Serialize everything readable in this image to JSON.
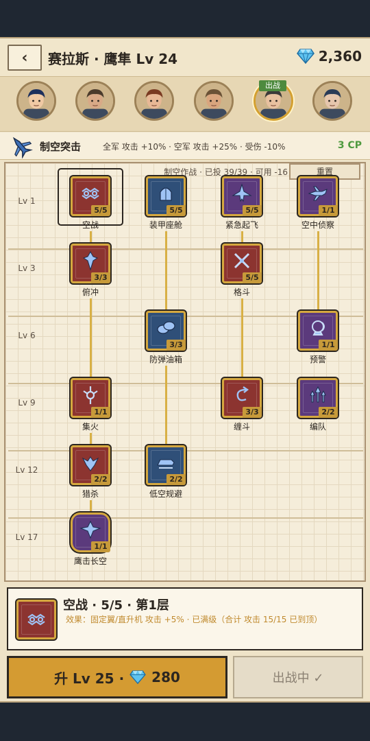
{
  "header": {
    "back_label": "‹",
    "title": "赛拉斯 · 鹰隼 Lv 24",
    "gems": "2,360"
  },
  "portraits": [
    {
      "name": "hero-1",
      "hair": "#1d2f5c",
      "skin": "#f0c9a4"
    },
    {
      "name": "hero-2",
      "hair": "#4a3a2b",
      "skin": "#d8a987"
    },
    {
      "name": "hero-3",
      "hair": "#7a3a22",
      "skin": "#e8b896"
    },
    {
      "name": "hero-4",
      "hair": "#6b5236",
      "skin": "#d9a57e"
    },
    {
      "name": "hero-5",
      "hair": "#3c3a3a",
      "skin": "#e8c1a0"
    },
    {
      "name": "hero-6",
      "hair": "#2a3b57",
      "skin": "#e6c6ad"
    }
  ],
  "deploy_tag": "出战",
  "skillbar": {
    "icon": "fighter-plane-icon",
    "name": "制空突击",
    "effects": "全军 攻击 +10% · 空军 攻击 +25% · 受伤 -10%",
    "cp": "3 CP"
  },
  "tree": {
    "info": "制空作战 · 已投 39/39 · 可用 -16",
    "reset_label": "重置",
    "levels": [
      "Lv 1",
      "Lv 3",
      "Lv 6",
      "Lv 9",
      "Lv 12",
      "Lv 17"
    ],
    "nodes": [
      {
        "id": "air-combat",
        "name": "空战",
        "count": "5/5",
        "color": "red"
      },
      {
        "id": "armored-cockpit",
        "name": "装甲座舱",
        "count": "5/5",
        "color": "blue"
      },
      {
        "id": "scramble",
        "name": "紧急起飞",
        "count": "5/5",
        "color": "purple"
      },
      {
        "id": "air-recon",
        "name": "空中侦察",
        "count": "1/1",
        "color": "purple"
      },
      {
        "id": "dive",
        "name": "俯冲",
        "count": "3/3",
        "color": "red"
      },
      {
        "id": "dogfight",
        "name": "格斗",
        "count": "5/5",
        "color": "red"
      },
      {
        "id": "self-sealing-tank",
        "name": "防弹油箱",
        "count": "3/3",
        "color": "blue"
      },
      {
        "id": "early-warning",
        "name": "预警",
        "count": "1/1",
        "color": "purple"
      },
      {
        "id": "focus-fire",
        "name": "集火",
        "count": "1/1",
        "color": "red"
      },
      {
        "id": "tangle",
        "name": "缠斗",
        "count": "3/3",
        "color": "red"
      },
      {
        "id": "formation",
        "name": "编队",
        "count": "2/2",
        "color": "purple"
      },
      {
        "id": "hunter",
        "name": "猎杀",
        "count": "2/2",
        "color": "red"
      },
      {
        "id": "low-altitude-evasion",
        "name": "低空规避",
        "count": "2/2",
        "color": "blue"
      },
      {
        "id": "hawk-strike",
        "name": "鹰击长空",
        "count": "1/1",
        "color": "purple"
      }
    ]
  },
  "detail": {
    "title": "空战 · 5/5 · 第1层",
    "effect": "效果：固定翼/直升机 攻击 +5% · 已满级（合计 攻击 15/15 已到顶）"
  },
  "buttons": {
    "upgrade_level": "升 Lv 25 ·",
    "upgrade_cost": "280",
    "deployed": "出战中 ✓"
  },
  "colors": {
    "red_node": "#8c3430",
    "blue_node": "#2f4f78",
    "purple_node": "#5b3a7c",
    "gold": "#d5a83f",
    "cp_green": "#4f9a3f"
  }
}
